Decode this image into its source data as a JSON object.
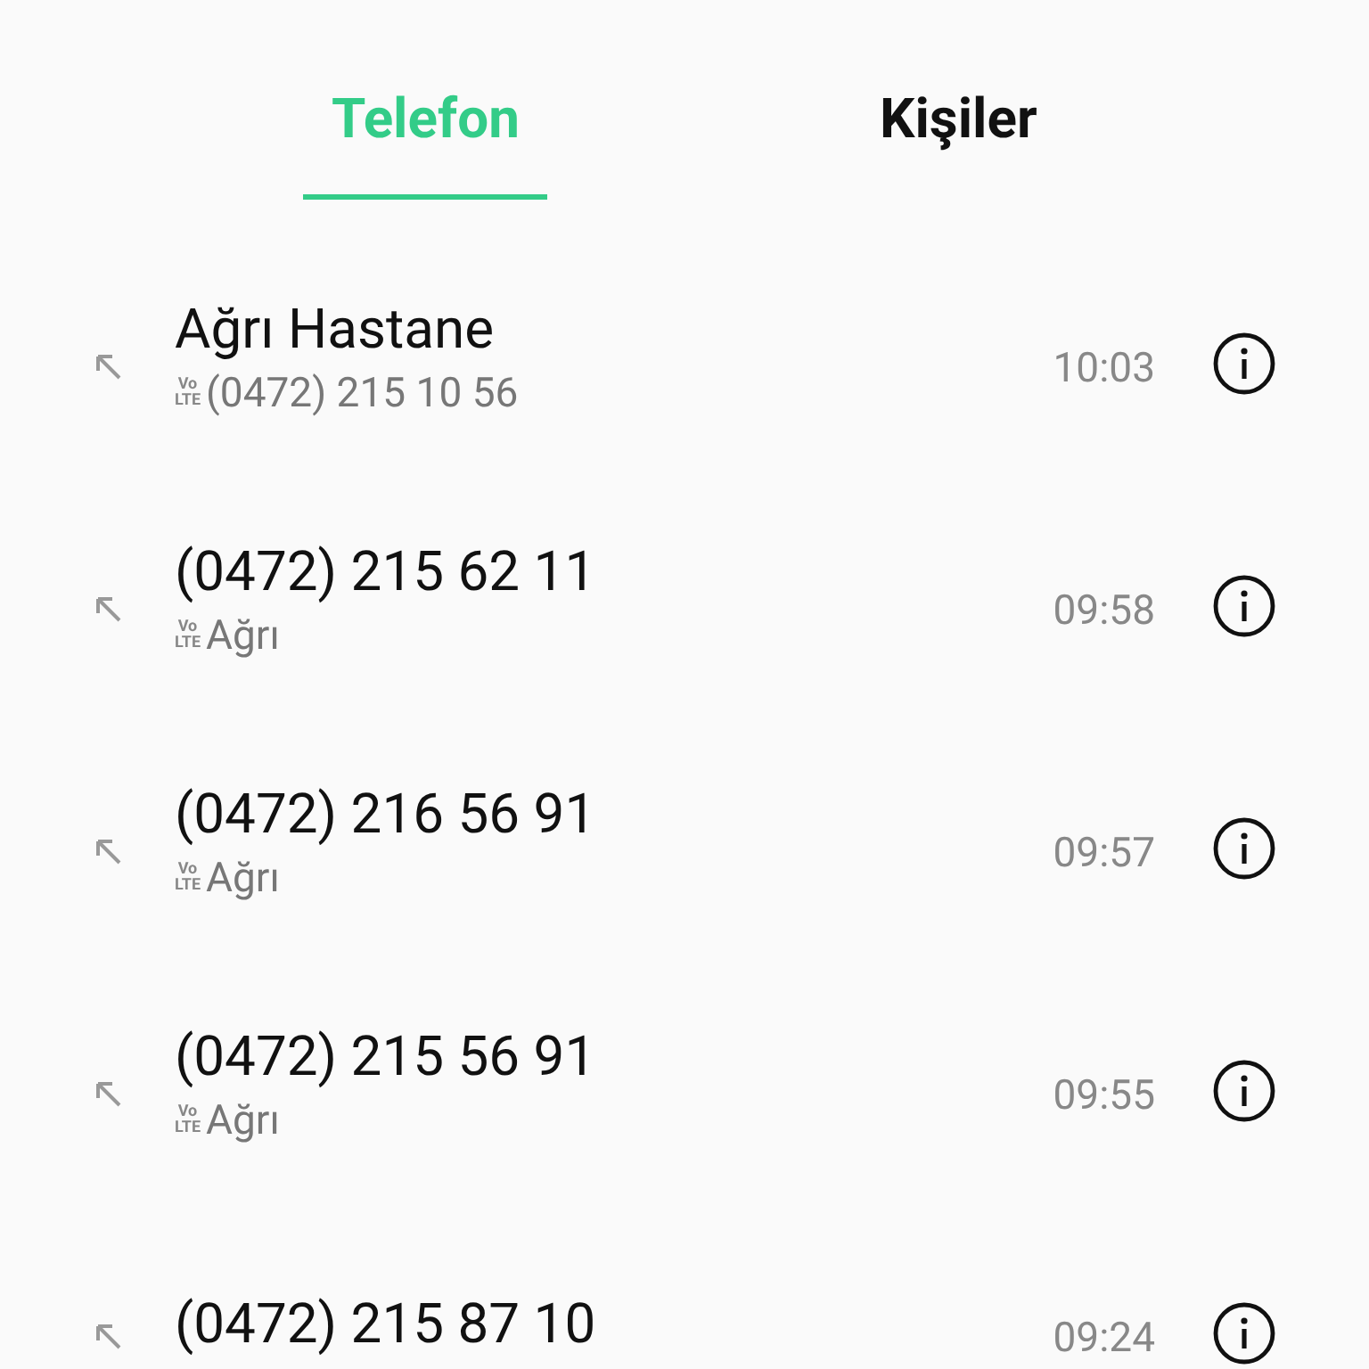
{
  "tabs": [
    {
      "label": "Telefon",
      "selected": true
    },
    {
      "label": "Kişiler",
      "selected": false
    }
  ],
  "calls": [
    {
      "name": "Ağrı Hastane",
      "network": [
        "Vo",
        "LTE"
      ],
      "detail": "(0472) 215 10 56",
      "time": "10:03"
    },
    {
      "name": "(0472) 215 62 11",
      "network": [
        "Vo",
        "LTE"
      ],
      "detail": "Ağrı",
      "time": "09:58"
    },
    {
      "name": "(0472) 216 56 91",
      "network": [
        "Vo",
        "LTE"
      ],
      "detail": "Ağrı",
      "time": "09:57"
    },
    {
      "name": "(0472) 215 56 91",
      "network": [
        "Vo",
        "LTE"
      ],
      "detail": "Ağrı",
      "time": "09:55"
    },
    {
      "name": "(0472) 215 87 10",
      "time": "09:24"
    }
  ]
}
